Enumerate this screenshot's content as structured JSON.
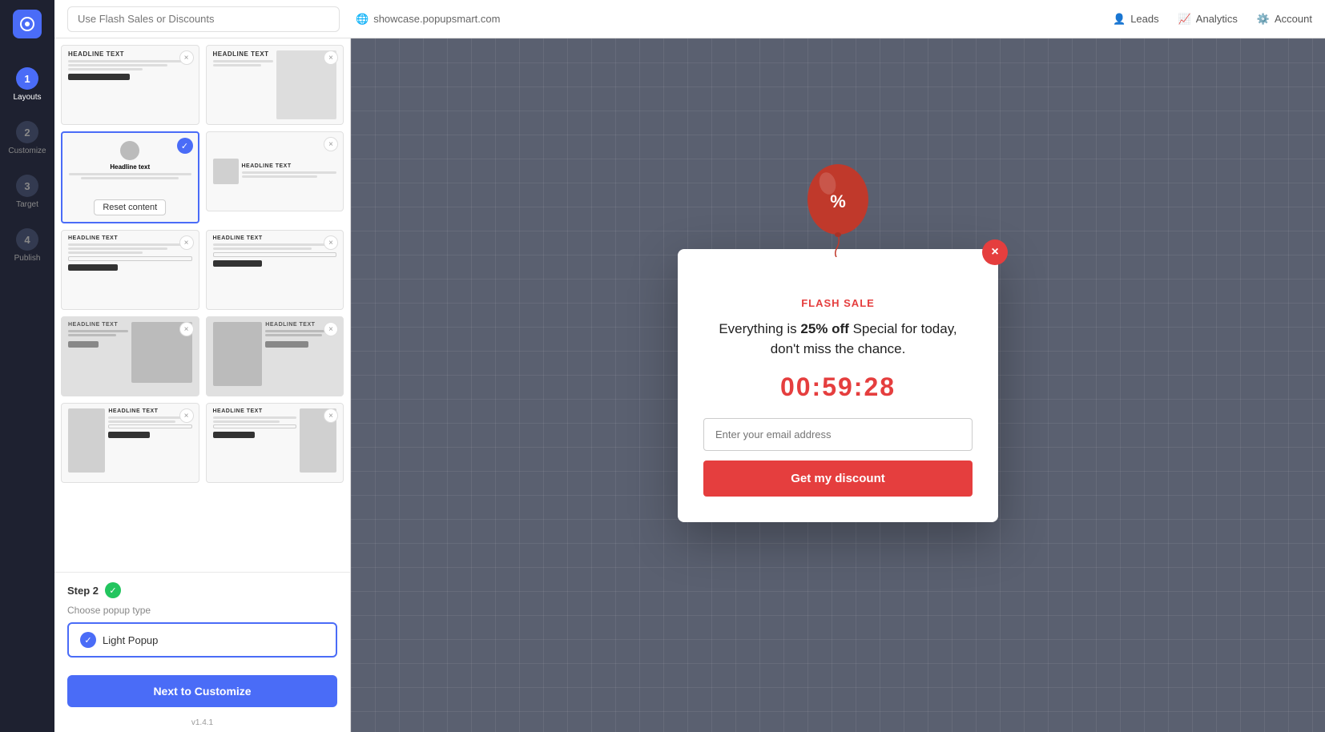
{
  "topbar": {
    "search_placeholder": "Use Flash Sales or Discounts",
    "url": "showcase.popupsmart.com",
    "leads_label": "Leads",
    "analytics_label": "Analytics",
    "account_label": "Account"
  },
  "nav": {
    "logo_alt": "PopupSmart",
    "steps": [
      {
        "num": "1",
        "label": "Layouts",
        "active": true
      },
      {
        "num": "2",
        "label": "Customize",
        "active": false
      },
      {
        "num": "3",
        "label": "Target",
        "active": false
      },
      {
        "num": "4",
        "label": "Publish",
        "active": false
      }
    ]
  },
  "layout_panel": {
    "cards": [
      {
        "id": "card-1",
        "type": "text-only",
        "selected": false
      },
      {
        "id": "card-2",
        "type": "text-right",
        "selected": false
      },
      {
        "id": "card-3",
        "type": "avatar-center",
        "selected": true,
        "reset_label": "Reset content"
      },
      {
        "id": "card-4",
        "type": "image-left",
        "selected": false
      },
      {
        "id": "card-5",
        "type": "text-form",
        "selected": false
      },
      {
        "id": "card-6",
        "type": "text-form-2",
        "selected": false
      },
      {
        "id": "card-7",
        "type": "image-split",
        "selected": false
      },
      {
        "id": "card-8",
        "type": "image-split-2",
        "selected": false
      },
      {
        "id": "card-9",
        "type": "text-form-img",
        "selected": false
      },
      {
        "id": "card-10",
        "type": "text-form-img-2",
        "selected": false
      }
    ]
  },
  "step2": {
    "label": "Step 2",
    "sublabel": "Choose popup type",
    "popup_type": "Light Popup"
  },
  "next_button": {
    "label": "Next to Customize"
  },
  "version": "v1.4.1",
  "popup": {
    "close_aria": "Close",
    "flash_label": "FLASH SALE",
    "headline_prefix": "Everything is ",
    "headline_bold": "25% off",
    "headline_suffix": " Special for today, don't miss the chance.",
    "timer": "00:59:28",
    "email_placeholder": "Enter your email address",
    "cta_label": "Get my discount"
  }
}
